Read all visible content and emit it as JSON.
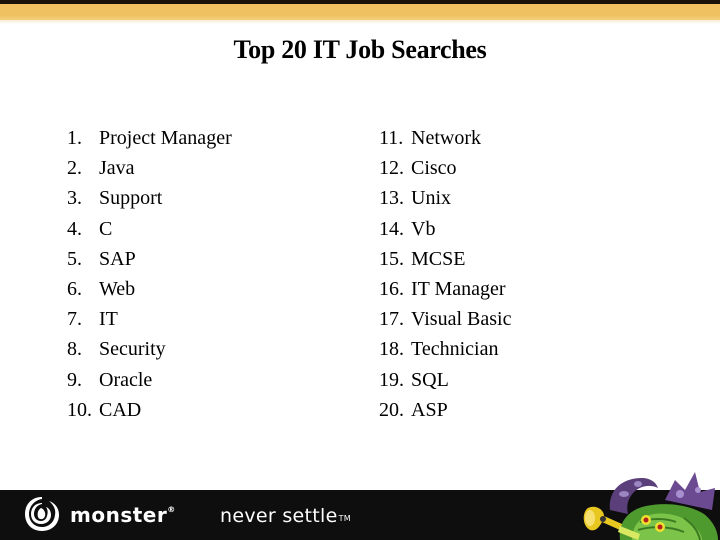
{
  "slide": {
    "title": "Top 20 IT Job Searches",
    "left_list": [
      {
        "num": "1.",
        "label": "Project Manager"
      },
      {
        "num": "2.",
        "label": "Java"
      },
      {
        "num": "3.",
        "label": "Support"
      },
      {
        "num": "4.",
        "label": "C"
      },
      {
        "num": "5.",
        "label": "SAP"
      },
      {
        "num": "6.",
        "label": "Web"
      },
      {
        "num": "7.",
        "label": "IT"
      },
      {
        "num": "8.",
        "label": "Security"
      },
      {
        "num": "9.",
        "label": "Oracle"
      },
      {
        "num": "10.",
        "label": "CAD"
      }
    ],
    "right_list": [
      {
        "num": "11.",
        "label": "Network"
      },
      {
        "num": "12.",
        "label": "Cisco"
      },
      {
        "num": "13.",
        "label": "Unix"
      },
      {
        "num": "14.",
        "label": "Vb"
      },
      {
        "num": "15.",
        "label": "MCSE"
      },
      {
        "num": "16.",
        "label": "IT Manager"
      },
      {
        "num": "17.",
        "label": "Visual Basic"
      },
      {
        "num": "18.",
        "label": "Technician"
      },
      {
        "num": "19.",
        "label": "SQL"
      },
      {
        "num": "20.",
        "label": "ASP"
      }
    ]
  },
  "footer": {
    "brand": "monster",
    "brand_mark": "®",
    "tagline": "never settle",
    "tagline_mark": "TM",
    "logo_icon": "monster-swirl-logo-icon",
    "mascot_icon": "green-monster-mascot-icon"
  },
  "colors": {
    "header_gold": "#f0c060",
    "header_dark": "#1a120a",
    "footer_bg": "#0e0e0e",
    "text": "#000000"
  }
}
